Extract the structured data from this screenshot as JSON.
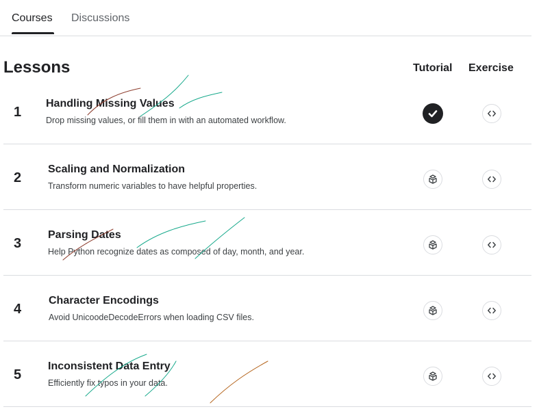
{
  "tabs": [
    {
      "label": "Courses",
      "active": true
    },
    {
      "label": "Discussions",
      "active": false
    }
  ],
  "section_title": "Lessons",
  "columns": {
    "tutorial": "Tutorial",
    "exercise": "Exercise"
  },
  "lessons": [
    {
      "number": "1",
      "title": "Handling Missing Values",
      "description": "Drop missing values, or fill them in with an automated workflow.",
      "tutorial_status": "completed",
      "tutorial_icon": "check-icon",
      "exercise_icon": "code-brackets-icon"
    },
    {
      "number": "2",
      "title": "Scaling and Normalization",
      "description": "Transform numeric variables to have helpful properties.",
      "tutorial_status": "not-started",
      "tutorial_icon": "book-icon",
      "exercise_icon": "code-brackets-icon"
    },
    {
      "number": "3",
      "title": "Parsing Dates",
      "description": "Help Python recognize dates as composed of day, month, and year.",
      "tutorial_status": "not-started",
      "tutorial_icon": "book-icon",
      "exercise_icon": "code-brackets-icon"
    },
    {
      "number": "4",
      "title": "Character Encodings",
      "description": "Avoid UnicoodeDecodeErrors when loading CSV files.",
      "tutorial_status": "not-started",
      "tutorial_icon": "book-icon",
      "exercise_icon": "code-brackets-icon"
    },
    {
      "number": "5",
      "title": "Inconsistent Data Entry",
      "description": "Efficiently fix typos in your data.",
      "tutorial_status": "not-started",
      "tutorial_icon": "book-icon",
      "exercise_icon": "code-brackets-icon"
    }
  ],
  "colors": {
    "text": "#202124",
    "muted": "#5f6368",
    "divider": "#dadce0",
    "done_badge": "#202124",
    "scribble_teal": "#14a88a",
    "scribble_brown": "#8b3a2a",
    "scribble_orange": "#b5651d"
  }
}
